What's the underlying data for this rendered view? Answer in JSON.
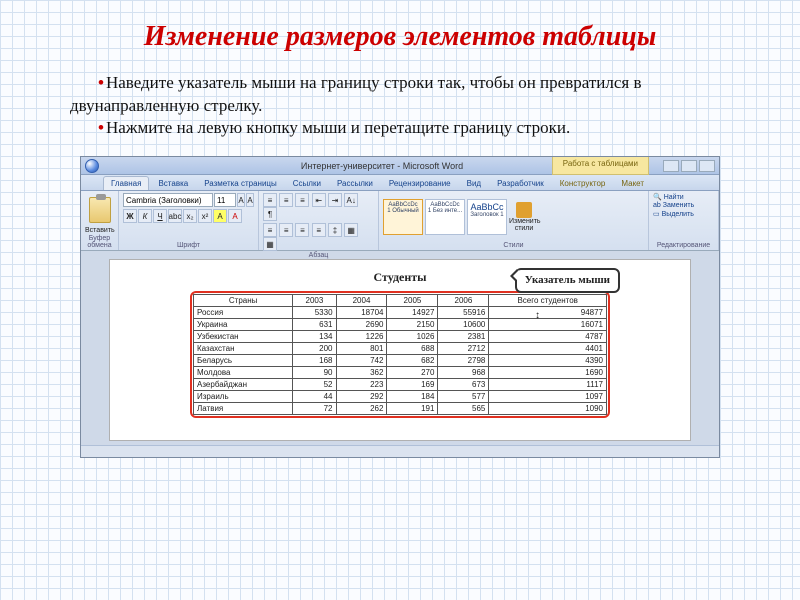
{
  "title": "Изменение размеров элементов таблицы",
  "bullets": [
    "Наведите указатель мыши на границу строки так, чтобы он превратился в двунаправленную стрелку.",
    "Нажмите на левую кнопку мыши и перетащите границу строки."
  ],
  "window": {
    "title": "Интернет-университет - Microsoft Word",
    "context_tab": "Работа с таблицами"
  },
  "tabs": [
    "Главная",
    "Вставка",
    "Разметка страницы",
    "Ссылки",
    "Рассылки",
    "Рецензирование",
    "Вид",
    "Разработчик",
    "Конструктор",
    "Макет"
  ],
  "active_tab": "Главная",
  "font": {
    "name": "Cambria (Заголовки)",
    "size": "11"
  },
  "groups": {
    "paste": "Вставить",
    "clipboard": "Буфер обмена",
    "font": "Шрифт",
    "para": "Абзац",
    "styles": "Стили",
    "change": "Изменить стили",
    "edit": "Редактирование"
  },
  "style_cards": [
    "AaBbCcDc",
    "AaBbCcDc",
    "AaBbCc"
  ],
  "style_labels": [
    "1 Обычный",
    "1 Без инте...",
    "Заголовок 1"
  ],
  "find": "Найти",
  "replace": "Заменить",
  "select": "Выделить",
  "doc_title": "Студенты",
  "callout": "Указатель мыши",
  "table": {
    "headers": [
      "Страны",
      "2003",
      "2004",
      "2005",
      "2006",
      "Всего студентов"
    ],
    "rows": [
      [
        "Россия",
        "5330",
        "18704",
        "14927",
        "55916",
        "94877"
      ],
      [
        "Украина",
        "631",
        "2690",
        "2150",
        "10600",
        "16071"
      ],
      [
        "Узбекистан",
        "134",
        "1226",
        "1026",
        "2381",
        "4787"
      ],
      [
        "Казахстан",
        "200",
        "801",
        "688",
        "2712",
        "4401"
      ],
      [
        "Беларусь",
        "168",
        "742",
        "682",
        "2798",
        "4390"
      ],
      [
        "Молдова",
        "90",
        "362",
        "270",
        "968",
        "1690"
      ],
      [
        "Азербайджан",
        "52",
        "223",
        "169",
        "673",
        "1117"
      ],
      [
        "Израиль",
        "44",
        "292",
        "184",
        "577",
        "1097"
      ],
      [
        "Латвия",
        "72",
        "262",
        "191",
        "565",
        "1090"
      ]
    ]
  }
}
